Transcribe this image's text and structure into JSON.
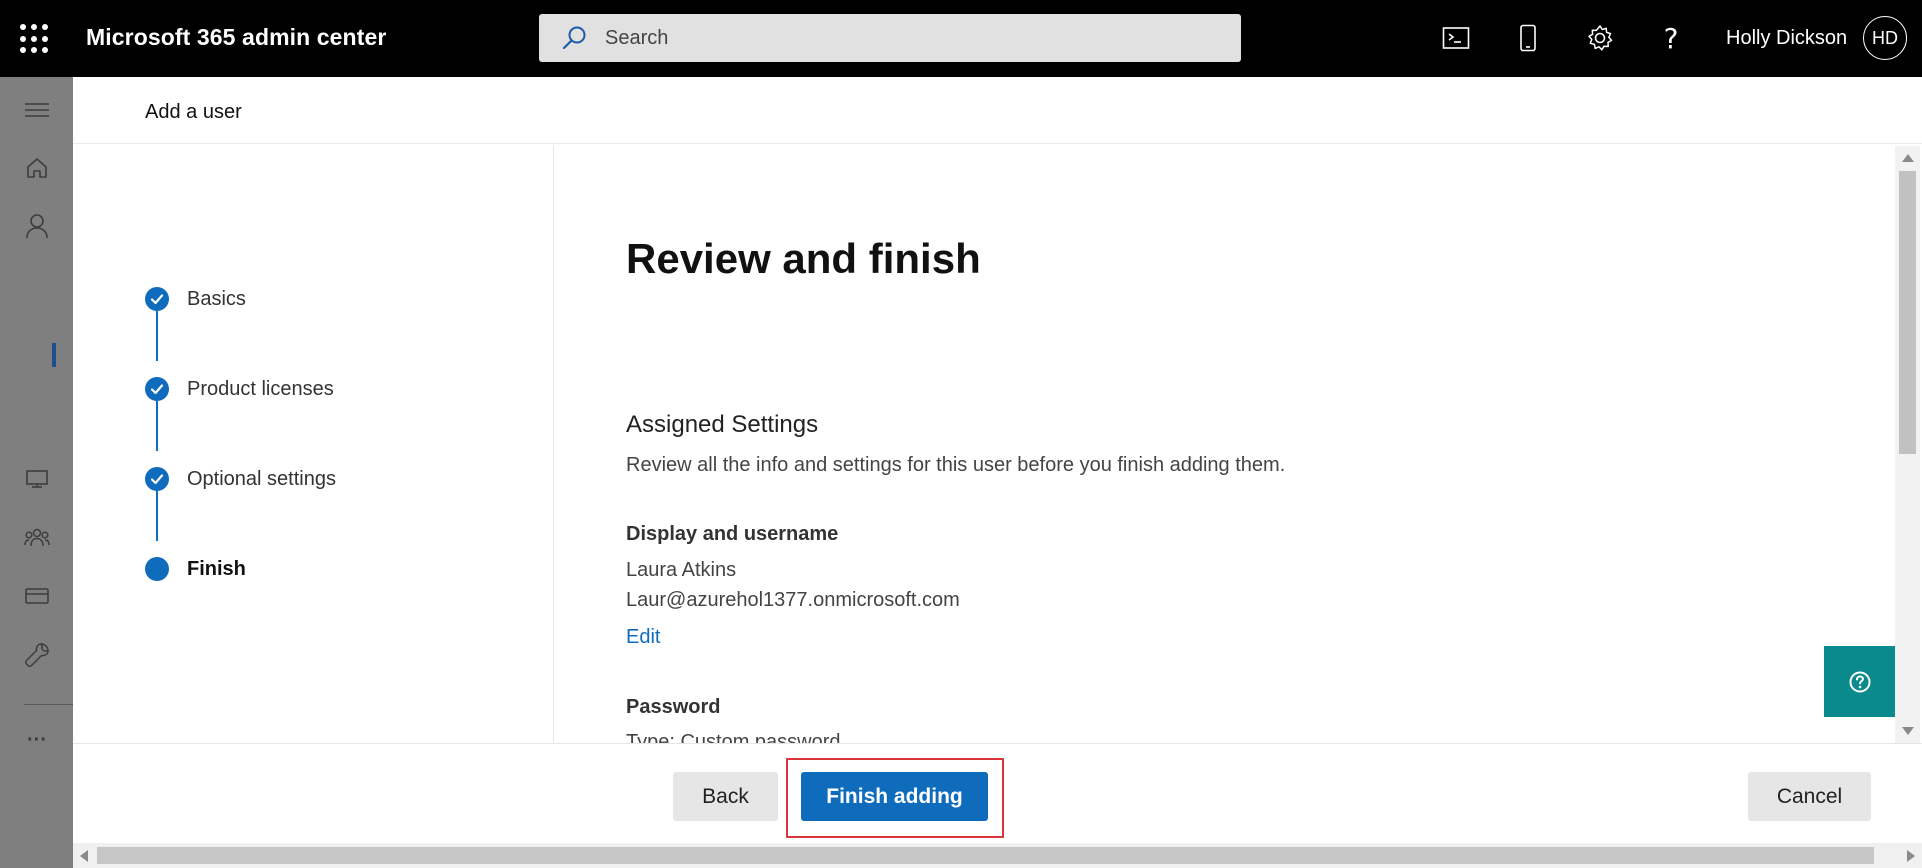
{
  "header": {
    "app_title": "Microsoft 365 admin center",
    "search_placeholder": "Search",
    "user_name": "Holly Dickson",
    "user_initials": "HD",
    "icons": [
      "waffle-icon",
      "search-icon",
      "terminal-icon",
      "mobile-icon",
      "gear-icon",
      "help-icon"
    ]
  },
  "rail": {
    "icons": [
      "menu-icon",
      "home-icon",
      "person-icon",
      "desktop-icon",
      "group-icon",
      "billing-icon",
      "wrench-icon",
      "more-icon"
    ],
    "more_label": "···"
  },
  "panel": {
    "title": "Add a user"
  },
  "steps": [
    {
      "label": "Basics",
      "state": "complete"
    },
    {
      "label": "Product licenses",
      "state": "complete"
    },
    {
      "label": "Optional settings",
      "state": "complete"
    },
    {
      "label": "Finish",
      "state": "current"
    }
  ],
  "content": {
    "heading": "Review and finish",
    "subheading": "Assigned Settings",
    "description": "Review all the info and settings for this user before you finish adding them.",
    "display_section": {
      "title": "Display and username",
      "display_name": "Laura Atkins",
      "username": "Laur@azurehol1377.onmicrosoft.com",
      "edit_label": "Edit"
    },
    "password_section": {
      "title": "Password",
      "type_text": "Type: Custom password"
    }
  },
  "footer": {
    "back_label": "Back",
    "finish_label": "Finish adding",
    "cancel_label": "Cancel"
  },
  "colors": {
    "accent": "#0f6cbd",
    "help_fab": "#0b8a8e",
    "highlight": "#d9343a"
  }
}
